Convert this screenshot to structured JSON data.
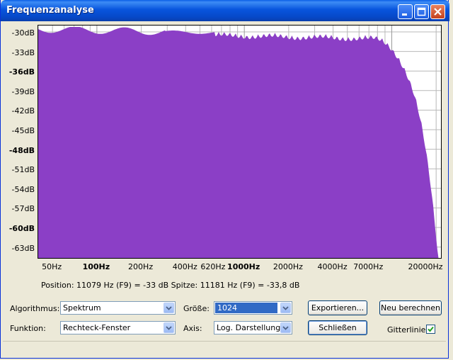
{
  "window": {
    "title": "Frequenzanalyse"
  },
  "plot": {
    "y_labels": [
      "-30dB",
      "-33dB",
      "-36dB",
      "-39dB",
      "-42dB",
      "-45dB",
      "-48dB",
      "-51dB",
      "-54dB",
      "-57dB",
      "-60dB",
      "-63dB"
    ],
    "x_labels": [
      "50Hz",
      "100Hz",
      "200Hz",
      "400Hz",
      "620Hz",
      "1000Hz",
      "2000Hz",
      "4000Hz",
      "7000Hz",
      "20000Hz"
    ],
    "fill_color": "#8b3fc6",
    "grid_color": "#b8b8b8"
  },
  "info": {
    "position_text": "Position: 11079 Hz (F9) = -33 dB  Spitze: 11181 Hz (F9) = -33,8 dB"
  },
  "controls": {
    "algorithm_label": "Algorithmus:",
    "algorithm_value": "Spektrum",
    "function_label": "Funktion:",
    "function_value": "Rechteck-Fenster",
    "size_label": "Größe:",
    "size_value": "1024",
    "axis_label": "Axis:",
    "axis_value": "Log. Darstellung",
    "export_button": "Exportieren...",
    "recalc_button": "Neu berechnen",
    "close_button": "Schließen",
    "grid_label": "Gitterlinien",
    "grid_checked": true
  }
}
